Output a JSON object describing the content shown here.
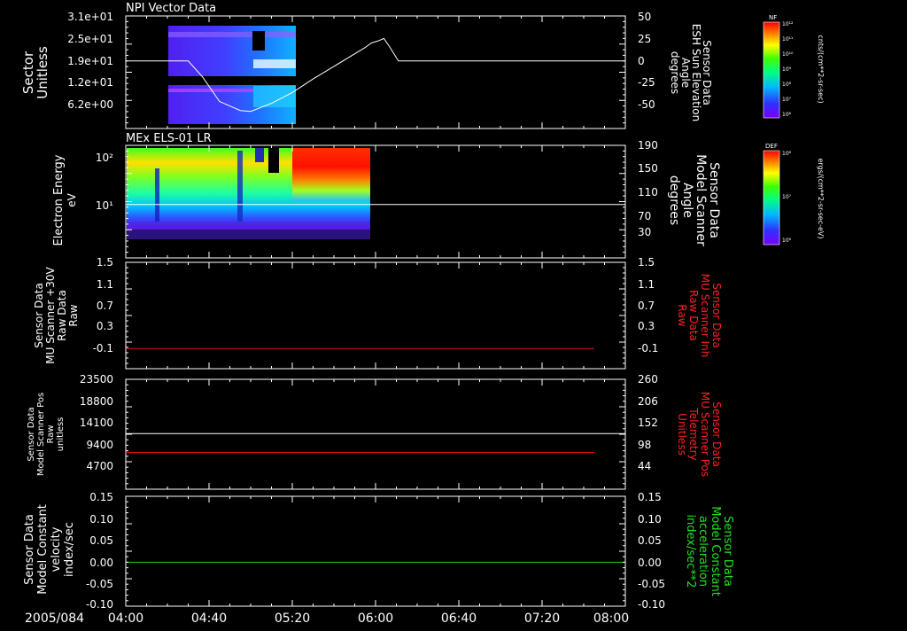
{
  "chart_data": [
    {
      "type": "line",
      "title": "NPI Vector Data",
      "ylabel": [
        "Sector",
        "Unitless"
      ],
      "y_ticks": [
        "3.1e+01",
        "2.5e+01",
        "1.9e+01",
        "1.2e+01",
        "6.2e+00"
      ],
      "ylabel_right": [
        "Sensor Data",
        "ESH Sun Elevation",
        "Angle",
        "degrees"
      ],
      "y_ticks_right": [
        "50",
        "25",
        "0",
        "-25",
        "-50"
      ],
      "ylim_right": [
        -75,
        50
      ],
      "spectrogram_window": {
        "start_min": 24,
        "end_min": 78,
        "color_scale": "NF"
      },
      "series": [
        {
          "color": "#ffffff",
          "axis": "right",
          "x_minutes": [
            0,
            30,
            37,
            45,
            50,
            55,
            60,
            70,
            80,
            90,
            100,
            110,
            115,
            118,
            121,
            124,
            127,
            131,
            240
          ],
          "values": [
            0,
            0,
            -18,
            -45,
            -50,
            -55,
            -56,
            -47,
            -35,
            -20,
            -6,
            8,
            15,
            20,
            22,
            25,
            15,
            0,
            0
          ]
        }
      ],
      "colorbar": {
        "label": "NF",
        "units": "cnts/(cm**2-sr-sec)",
        "ticks": [
          "10¹²",
          "10¹¹",
          "10¹⁰",
          "10⁹",
          "10⁸",
          "10⁷",
          "10⁶"
        ]
      }
    },
    {
      "type": "heatmap",
      "title": "MEx ELS-01 LR",
      "ylabel": [
        "Electron Energy",
        "eV"
      ],
      "y_ticks": [
        "10²",
        "10¹"
      ],
      "ylabel_right": [
        "Sensor Data",
        "Model Scanner",
        "Angle",
        "degrees"
      ],
      "y_ticks_right": [
        "190",
        "150",
        "110",
        "70",
        "30"
      ],
      "ylim_right": [
        0,
        190
      ],
      "data_window": {
        "start_min": 0,
        "end_min": 112
      },
      "series": [
        {
          "color": "#ffffff",
          "axis": "right",
          "x_minutes": [
            0,
            240
          ],
          "values": [
            90,
            90
          ]
        }
      ],
      "colorbar": {
        "label": "DEF",
        "units": "ergs/(cm**2-sr-sec-eV)",
        "ticks": [
          "10⁸",
          "10⁷",
          "10⁶"
        ]
      }
    },
    {
      "type": "line",
      "ylabel": [
        "Sensor Data",
        "MU Scanner +30V",
        "Raw Data",
        "Raw"
      ],
      "y_ticks": [
        "1.5",
        "1.1",
        "0.7",
        "0.3",
        "-0.1"
      ],
      "ylim": [
        -0.35,
        1.5
      ],
      "ylabel_right": [
        "Sensor Data",
        "MU Scanner Inh",
        "Raw Data",
        "Raw"
      ],
      "y_ticks_right": [
        "1.5",
        "1.1",
        "0.7",
        "0.3",
        "-0.1"
      ],
      "series": [
        {
          "color": "#e01010",
          "axis": "left",
          "x_minutes": [
            0,
            225
          ],
          "values": [
            0,
            0
          ]
        }
      ]
    },
    {
      "type": "line",
      "ylabel": [
        "Sensor Data",
        "Model Scanner Pos",
        "Raw",
        "unitless"
      ],
      "y_ticks": [
        "23500",
        "18800",
        "14100",
        "9400",
        "4700"
      ],
      "ylim": [
        0,
        23500
      ],
      "ylabel_right": [
        "Sensor Data",
        "MU Scanner Pos",
        "Telemetry",
        "Unitless"
      ],
      "y_ticks_right": [
        "260",
        "206",
        "152",
        "98",
        "44"
      ],
      "ylim_right": [
        0,
        260
      ],
      "series": [
        {
          "color": "#ffffff",
          "axis": "left",
          "x_minutes": [
            0,
            240
          ],
          "values": [
            11900,
            11900
          ]
        },
        {
          "color": "#e01010",
          "axis": "right",
          "x_minutes": [
            0,
            225
          ],
          "values": [
            87,
            87
          ]
        }
      ]
    },
    {
      "type": "line",
      "ylabel": [
        "Sensor Data",
        "Model Constant",
        "velocity",
        "index/sec"
      ],
      "y_ticks": [
        "0.15",
        "0.10",
        "0.05",
        "0.00",
        "-0.05",
        "-0.10"
      ],
      "ylim": [
        -0.1,
        0.15
      ],
      "ylabel_right": [
        "Sensor Data",
        "Model Constant",
        "acceleration",
        "index/sec**2"
      ],
      "y_ticks_right": [
        "0.15",
        "0.10",
        "0.05",
        "0.00",
        "-0.05",
        "-0.10"
      ],
      "series": [
        {
          "color": "#20d020",
          "axis": "left",
          "x_minutes": [
            0,
            240
          ],
          "values": [
            0,
            0
          ]
        }
      ]
    }
  ],
  "x_axis": {
    "date_label": "2005/084",
    "tick_labels": [
      "04:00",
      "04:40",
      "05:20",
      "06:00",
      "06:40",
      "07:20",
      "08:00"
    ],
    "range_minutes": [
      0,
      240
    ]
  },
  "colors": {
    "background": "#000000",
    "axes": "#ffffff",
    "left_label": "#ffffff",
    "right_label_panel3": "#ff2020",
    "right_label_panel4": "#ff2020",
    "right_label_panel5": "#20e020"
  }
}
